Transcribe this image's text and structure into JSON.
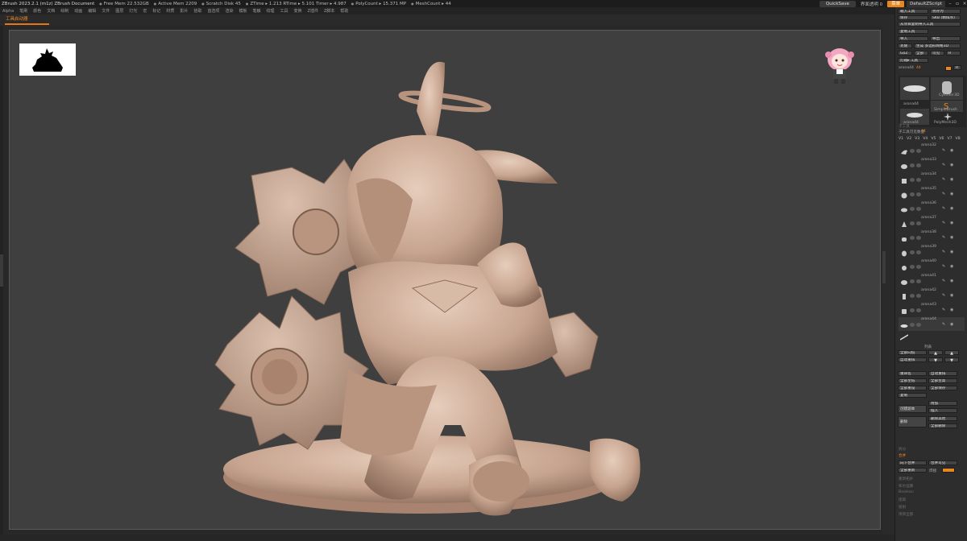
{
  "titlebar": {
    "title": "ZBrush 2023.2.1 (m1z)  ZBrush Document",
    "stats": [
      "Free Mem 22.532GB",
      "Active Mem 2209",
      "Scratch Disk 45",
      "ZTime ▸ 1.213 RTime ▸ 5.101 Timer ▸ 4.987",
      "PolyCount ▸ 15.371 MP",
      "MeshCount ▸ 44"
    ],
    "quicksave": "QuickSave",
    "transparency": "界面透明 0",
    "menu_button": "菜单",
    "default_script": "DefaultZScript"
  },
  "menubar": [
    "Alpha",
    "笔刷",
    "颜色",
    "文档",
    "绘制",
    "动画",
    "编辑",
    "文件",
    "图层",
    "灯光",
    "宏",
    "标记",
    "材质",
    "影片",
    "拾取",
    "首选项",
    "渲染",
    "模板",
    "笔触",
    "纹理",
    "工具",
    "变换",
    "Z插件",
    "Z脚本",
    "帮助"
  ],
  "active_tab": "工具启动器",
  "right_panel": {
    "buttons": {
      "load_tool": "载入工具",
      "save_as": "另存为",
      "save": "保存",
      "save_zbr": "SKB (精排序)",
      "project_copy": "从项目复制导入工具",
      "copy_tool": "复制工具",
      "import": "导入",
      "export": "导出",
      "clone": "克隆",
      "make_polymesh": "生成 多边形网格3D",
      "goz": "GoZ",
      "all": "全部",
      "visible": "可见",
      "r": "R",
      "lightbox": "灯箱▸ 工具"
    },
    "current_tool": "arona44",
    "current_tool_count": "44",
    "thumbs": [
      "arona44",
      "Cylinder3D",
      "SimpleBrush",
      "arona44",
      "PolyMesh3D"
    ],
    "subtool_header": "子工具",
    "subtool_count_label": "子工具可见数量",
    "subtool_count": "44",
    "versions": [
      "V1",
      "V2",
      "V3",
      "V4",
      "V5",
      "V6",
      "V7",
      "V8"
    ],
    "subtools": [
      "arona32",
      "arona33",
      "arona34",
      "arona35",
      "arona36",
      "arona37",
      "arona38",
      "arona39",
      "arona40",
      "arona41",
      "arona42",
      "arona43",
      "arona44"
    ],
    "list_label": "列表",
    "ops": {
      "all_low": "全部向低",
      "up": "▲",
      "down": "▼",
      "auto_reorder": "自动重排",
      "rename": "重命名",
      "auto_reorder2": "自动重排",
      "all_to_low": "全部至低",
      "all_to_high": "全部至高",
      "all_reset": "全部重设",
      "all_save": "全部保存",
      "copy": "复制",
      "append": "附加",
      "insert": "插入",
      "new_doc": "创建副本",
      "delete": "删除",
      "delete_other": "删除其他",
      "delete_all": "全部删除",
      "split": "拆分",
      "merge": "合并",
      "remesh_all": "全部重新",
      "merge_down": "向下合并",
      "create_pm": "合并可见",
      "weld": "焊接"
    },
    "misc_labels": [
      "拆分",
      "合并",
      "重新拓扑",
      "布尔运算",
      "Boolean",
      "提取",
      "投射",
      "项目全部"
    ]
  }
}
